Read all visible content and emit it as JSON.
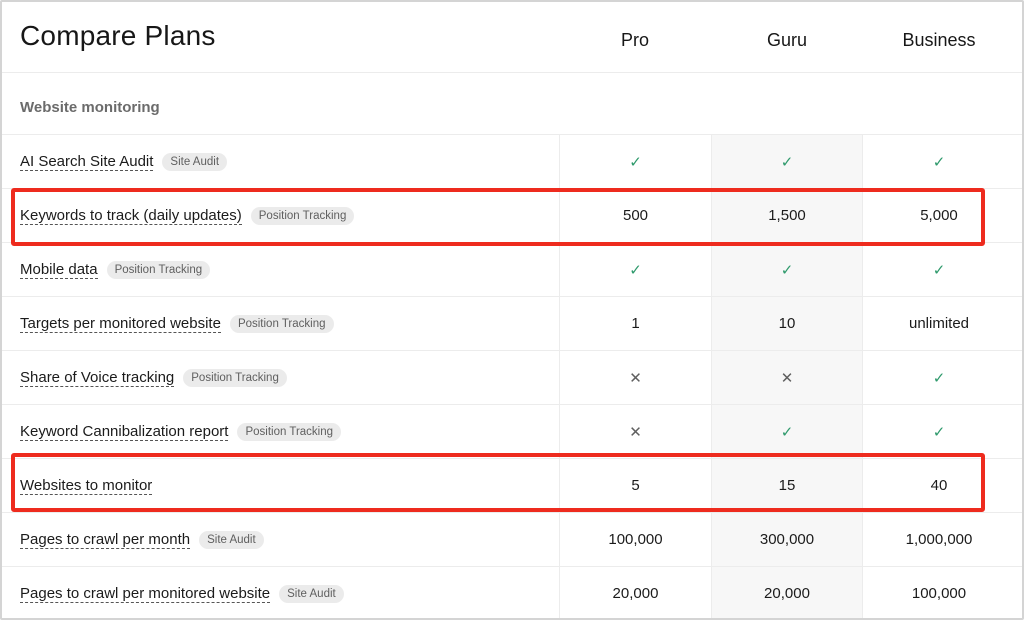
{
  "title": "Compare Plans",
  "plans": [
    "Pro",
    "Guru",
    "Business"
  ],
  "section": "Website monitoring",
  "rows": [
    {
      "feature": "AI Search Site Audit",
      "tag": "Site Audit",
      "values": [
        "✓",
        "✓",
        "✓"
      ]
    },
    {
      "feature": "Keywords to track (daily updates)",
      "tag": "Position Tracking",
      "values": [
        "500",
        "1,500",
        "5,000"
      ]
    },
    {
      "feature": "Mobile data",
      "tag": "Position Tracking",
      "values": [
        "✓",
        "✓",
        "✓"
      ]
    },
    {
      "feature": "Targets per monitored website",
      "tag": "Position Tracking",
      "values": [
        "1",
        "10",
        "unlimited"
      ]
    },
    {
      "feature": "Share of Voice tracking",
      "tag": "Position Tracking",
      "values": [
        "✕",
        "✕",
        "✓"
      ]
    },
    {
      "feature": "Keyword Cannibalization report",
      "tag": "Position Tracking",
      "values": [
        "✕",
        "✓",
        "✓"
      ]
    },
    {
      "feature": "Websites to monitor",
      "tag": "",
      "values": [
        "5",
        "15",
        "40"
      ]
    },
    {
      "feature": "Pages to crawl per month",
      "tag": "Site Audit",
      "values": [
        "100,000",
        "300,000",
        "1,000,000"
      ]
    },
    {
      "feature": "Pages to crawl per monitored website",
      "tag": "Site Audit",
      "values": [
        "20,000",
        "20,000",
        "100,000"
      ]
    }
  ],
  "colors": {
    "check": "#2f9a6c",
    "highlight": "#ee2b1e"
  }
}
